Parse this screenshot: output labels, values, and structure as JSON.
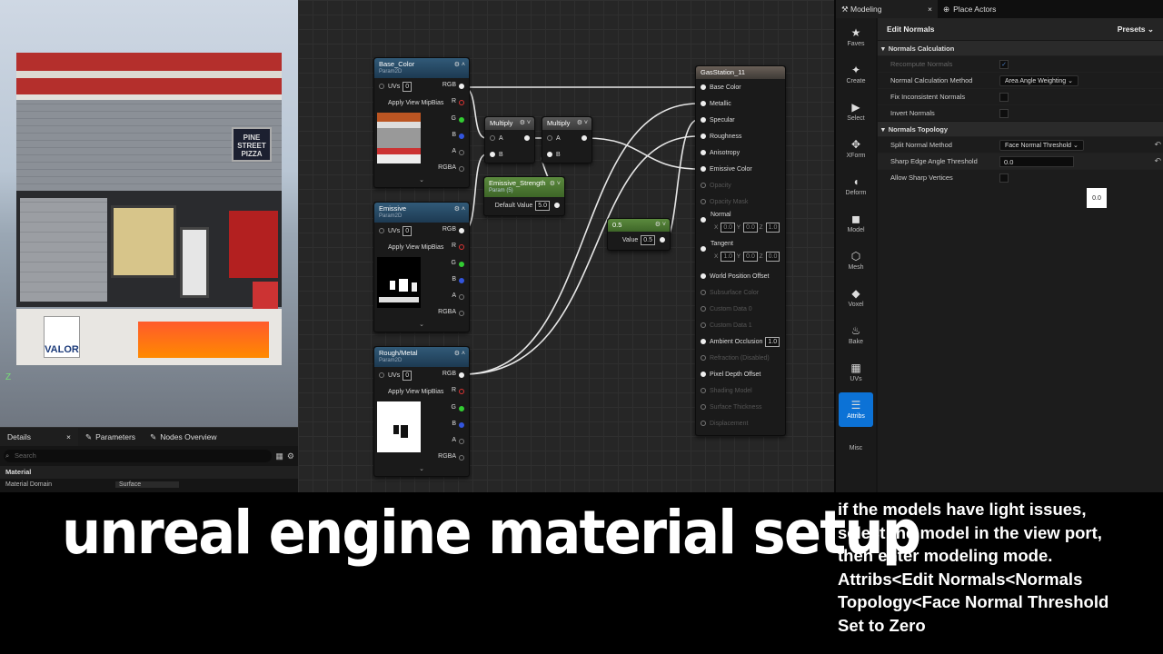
{
  "viewport": {
    "sign_text": "PINE STREET PIZZA",
    "brand_text": "VALOR",
    "axis_label": "Z"
  },
  "details": {
    "tabs": [
      {
        "label": "Details",
        "close": "×"
      },
      {
        "label": "Parameters"
      },
      {
        "label": "Nodes Overview"
      }
    ],
    "search_placeholder": "Search",
    "section": "Material",
    "domain_label": "Material Domain",
    "domain_value": "Surface"
  },
  "graph": {
    "base_color_node": {
      "title": "Base_Color",
      "sub": "Param2D",
      "uvs": "UVs",
      "uvs_value": "0",
      "mip": "Apply View MipBias",
      "outs": [
        "RGB",
        "R",
        "G",
        "B",
        "A",
        "RGBA"
      ]
    },
    "emissive_node": {
      "title": "Emissive",
      "sub": "Param2D",
      "uvs": "UVs",
      "uvs_value": "0",
      "mip": "Apply View MipBias",
      "outs": [
        "RGB",
        "R",
        "G",
        "B",
        "A",
        "RGBA"
      ]
    },
    "rough_node": {
      "title": "Rough/Metal",
      "sub": "Param2D",
      "uvs": "UVs",
      "uvs_value": "0",
      "mip": "Apply View MipBias",
      "outs": [
        "RGB",
        "R",
        "G",
        "B",
        "A",
        "RGBA"
      ]
    },
    "multiply1": {
      "title": "Multiply",
      "a": "A",
      "b": "B"
    },
    "multiply2": {
      "title": "Multiply",
      "a": "A",
      "b": "B"
    },
    "emissive_strength": {
      "title": "Emissive_Strength",
      "sub": "Param (5)",
      "label": "Default Value",
      "value": "5.0"
    },
    "const_node": {
      "title": "0.5",
      "label": "Value",
      "value": "0.5"
    },
    "result_node": {
      "title": "GasStation_11",
      "pins": [
        {
          "label": "Base Color",
          "active": true
        },
        {
          "label": "Metallic",
          "active": true
        },
        {
          "label": "Specular",
          "active": true
        },
        {
          "label": "Roughness",
          "active": true
        },
        {
          "label": "Anisotropy",
          "active": true
        },
        {
          "label": "Emissive Color",
          "active": true
        },
        {
          "label": "Opacity",
          "active": false
        },
        {
          "label": "Opacity Mask",
          "active": false
        }
      ],
      "normal": {
        "label": "Normal",
        "x": "0.0",
        "y": "0.0",
        "z": "1.0"
      },
      "tangent": {
        "label": "Tangent",
        "x": "1.0",
        "y": "0.0",
        "z": "0.0"
      },
      "pins2": [
        {
          "label": "World Position Offset",
          "active": true
        },
        {
          "label": "Subsurface Color",
          "active": false
        },
        {
          "label": "Custom Data 0",
          "active": false
        },
        {
          "label": "Custom Data 1",
          "active": false
        }
      ],
      "ambient": {
        "label": "Ambient Occlusion",
        "value": "1.0"
      },
      "pins3": [
        {
          "label": "Refraction (Disabled)",
          "active": false
        },
        {
          "label": "Pixel Depth Offset",
          "active": true
        },
        {
          "label": "Shading Model",
          "active": false
        },
        {
          "label": "Surface Thickness",
          "active": false
        },
        {
          "label": "Displacement",
          "active": false
        }
      ]
    }
  },
  "modeling": {
    "tabs": [
      {
        "label": "Modeling",
        "close": "×"
      },
      {
        "label": "Place Actors"
      }
    ],
    "tools": [
      {
        "label": "Faves",
        "icon": "★"
      },
      {
        "label": "Create",
        "icon": "✦"
      },
      {
        "label": "Select",
        "icon": "▶"
      },
      {
        "label": "XForm",
        "icon": "✥"
      },
      {
        "label": "Deform",
        "icon": "◖"
      },
      {
        "label": "Model",
        "icon": "◼"
      },
      {
        "label": "Mesh",
        "icon": "⬡"
      },
      {
        "label": "Voxel",
        "icon": "◆"
      },
      {
        "label": "Bake",
        "icon": "♨"
      },
      {
        "label": "UVs",
        "icon": "▦"
      },
      {
        "label": "Attribs",
        "icon": "☰"
      },
      {
        "label": "Misc",
        "icon": ""
      }
    ],
    "active_tool": "Attribs",
    "panel_title": "Edit Normals",
    "presets": "Presets",
    "cat_calc": "Normals Calculation",
    "recompute": "Recompute Normals",
    "calc_method_label": "Normal Calculation Method",
    "calc_method_value": "Area Angle Weighting",
    "fix_label": "Fix Inconsistent Normals",
    "invert_label": "Invert Normals",
    "cat_topology": "Normals Topology",
    "split_label": "Split Normal Method",
    "split_value": "Face Normal Threshold",
    "sharp_label": "Sharp Edge Angle Threshold",
    "sharp_value": "0.0",
    "allow_label": "Allow Sharp Vertices",
    "tooltip_value": "0.0"
  },
  "captions": {
    "main": "unreal engine material setup",
    "note_lines": [
      "if the models have light issues,",
      "select the model in the view port,",
      "then enter modeling mode.",
      "Attribs<Edit Normals<Normals",
      "Topology<Face Normal Threshold",
      "Set to Zero"
    ]
  },
  "colors": {
    "active_tool": "#0c72d6",
    "texture_header": "#315a78",
    "scalar_header": "#5b8a3e",
    "caption": "#ffffff"
  }
}
